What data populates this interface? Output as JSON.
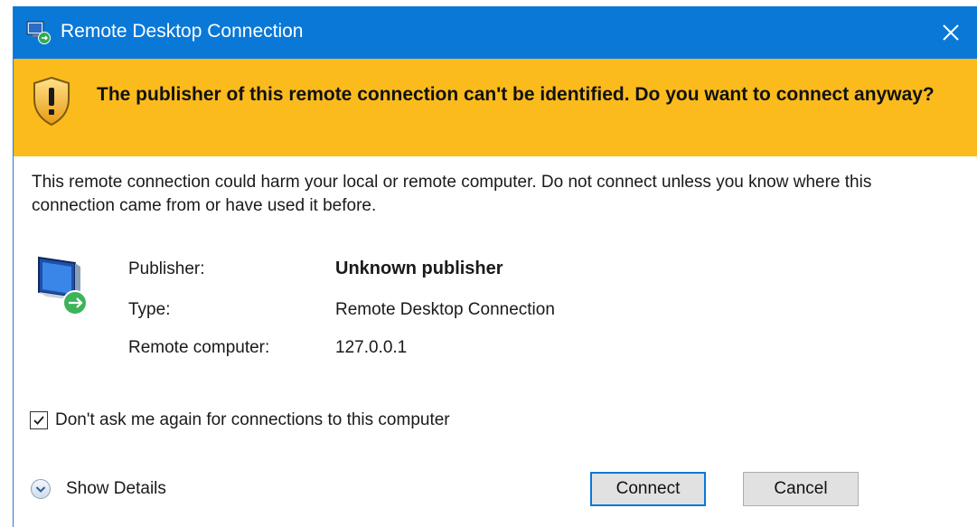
{
  "window": {
    "title": "Remote Desktop Connection"
  },
  "warning": {
    "message": "The publisher of this remote connection can't be identified. Do you want to connect anyway?"
  },
  "description": "This remote connection could harm your local or remote computer. Do not connect unless you know where this connection came from or have used it before.",
  "connection_info": {
    "publisher_label": "Publisher:",
    "publisher_value": "Unknown publisher",
    "type_label": "Type:",
    "type_value": "Remote Desktop Connection",
    "remote_label": "Remote computer:",
    "remote_value": "127.0.0.1"
  },
  "dont_ask": {
    "label": "Don't ask me again for connections to this computer",
    "checked": true
  },
  "show_details_label": "Show Details",
  "buttons": {
    "connect": "Connect",
    "cancel": "Cancel"
  },
  "colors": {
    "titlebar": "#0a78d7",
    "warning_bar": "#fbbb1d",
    "default_button_border": "#0a78d7"
  }
}
